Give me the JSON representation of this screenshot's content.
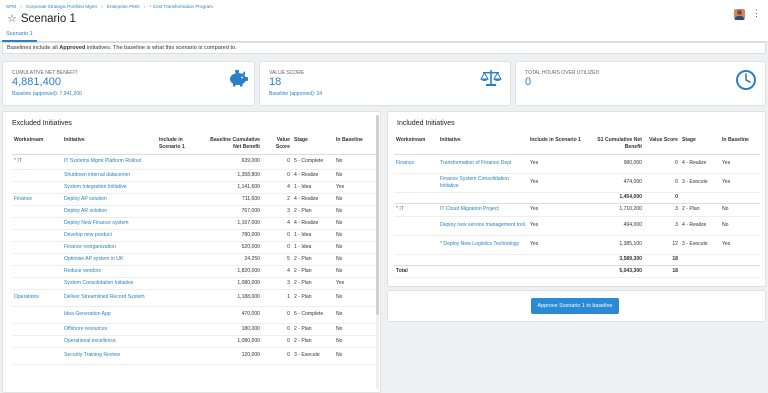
{
  "header": {
    "breadcrumb": [
      "SPM",
      "›",
      "Corporate Strategic Portfolio Mgmt",
      "›",
      "Enterprise PMO",
      "›",
      "* Cost Transformation Program"
    ],
    "title": "Scenario 1",
    "tab": "Scenario 1"
  },
  "info": {
    "prefix": "Baselines include all ",
    "bold": "Approved",
    "suffix": " initiatives. The baseline is what this scenario is compared to."
  },
  "kpis": [
    {
      "label": "Cumulative Net Benefit",
      "value": "4,881,400",
      "baseline": "Baseline (approved): 7,941,200",
      "icon": "piggy-bank-icon"
    },
    {
      "label": "Value Score",
      "value": "18",
      "baseline": "Baseline (approved): 24",
      "icon": "scales-icon"
    },
    {
      "label": "Total Hours Over Utilized",
      "value": "0",
      "baseline": "",
      "icon": "clock-icon"
    }
  ],
  "excluded": {
    "title": "Excluded Initiatives",
    "columns": [
      "Workstream",
      "Initiative",
      "Include in Scenario 1",
      "Baseline Cumulative Net Benefit",
      "Value Score",
      "Stage",
      "In Baseline"
    ],
    "rows": [
      [
        "* IT",
        "IT Systems Mgmt Platform Rollout",
        "",
        "639,000",
        "0",
        "5 - Complete",
        "No"
      ],
      [
        "",
        "Shutdown internal datacenter",
        "",
        "1,358,800",
        "0",
        "4 - Realize",
        "No"
      ],
      [
        "",
        "System Integration Initiative",
        "",
        "1,141,600",
        "4",
        "1 - Idea",
        "Yes"
      ],
      [
        "Finance",
        "Deploy AP solution",
        "",
        "711,600",
        "2",
        "4 - Realize",
        "No"
      ],
      [
        "",
        "Deploy AR solution",
        "",
        "767,000",
        "3",
        "2 - Plan",
        "No"
      ],
      [
        "",
        "Deploy New Finance system",
        "",
        "1,167,000",
        "4",
        "4 - Realize",
        "No"
      ],
      [
        "",
        "Develop new product",
        "",
        "780,000",
        "0",
        "1 - Idea",
        "No"
      ],
      [
        "",
        "Finance reorganization",
        "",
        "520,000",
        "0",
        "1 - Idea",
        "No"
      ],
      [
        "",
        "Optimise AP system in UK",
        "",
        "24,250",
        "5",
        "2 - Plan",
        "No"
      ],
      [
        "",
        "Reduce vendors",
        "",
        "1,820,000",
        "4",
        "2 - Plan",
        "No"
      ],
      [
        "",
        "System Consolidation Initiative",
        "",
        "1,080,000",
        "3",
        "2 - Plan",
        "Yes"
      ],
      [
        "Operations",
        "Deliver Streamlined Record System",
        "",
        "1,188,000",
        "1",
        "2 - Plan",
        "No"
      ],
      [
        "",
        "Idea Generation App",
        "",
        "470,000",
        "0",
        "5 - Complete",
        "No"
      ],
      [
        "",
        "Offshore resources",
        "",
        "180,000",
        "0",
        "2 - Plan",
        "No"
      ],
      [
        "",
        "Operational excellence",
        "",
        "1,080,000",
        "0",
        "2 - Plan",
        "No"
      ],
      [
        "",
        "Security Training Review",
        "",
        "120,000",
        "0",
        "3 - Execute",
        "No"
      ]
    ]
  },
  "included": {
    "title": "Included Initiatives",
    "columns": [
      "Workstream",
      "Initiative",
      "Include in Scenario 1",
      "S1 Cumulative Net Benefit",
      "Value Score",
      "Stage",
      "In Baseline"
    ],
    "rows": [
      {
        "type": "row",
        "cells": [
          "Finance",
          "Transformation of Finance Dept",
          "Yes",
          "980,000",
          "0",
          "4 - Realize",
          "Yes"
        ]
      },
      {
        "type": "row",
        "cells": [
          "",
          "Finance System Consolidation Initiative",
          "Yes",
          "474,000",
          "0",
          "3 - Execute",
          "Yes"
        ]
      },
      {
        "type": "subtotal",
        "cells": [
          "",
          "",
          "",
          "1,454,000",
          "0",
          "",
          ""
        ]
      },
      {
        "type": "row",
        "cells": [
          "* IT",
          "IT Cloud Migration Project",
          "Yes",
          "1,710,200",
          "3",
          "2 - Plan",
          "No"
        ]
      },
      {
        "type": "row",
        "cells": [
          "",
          "Deploy new service management tool",
          "Yes",
          "494,000",
          "3",
          "4 - Realize",
          "No"
        ]
      },
      {
        "type": "row",
        "cells": [
          "",
          "* Deploy New Logistics Technology",
          "Yes",
          "1,385,100",
          "12",
          "3 - Execute",
          "Yes"
        ]
      },
      {
        "type": "subtotal",
        "cells": [
          "",
          "",
          "",
          "3,589,300",
          "18",
          "",
          ""
        ]
      },
      {
        "type": "total",
        "cells": [
          "Total",
          "",
          "",
          "5,043,300",
          "18",
          "",
          ""
        ]
      }
    ],
    "button": "Approve Scenario 1 to baseline"
  },
  "colors": {
    "accent": "#2a7fc9",
    "button": "#2a8bd4"
  }
}
